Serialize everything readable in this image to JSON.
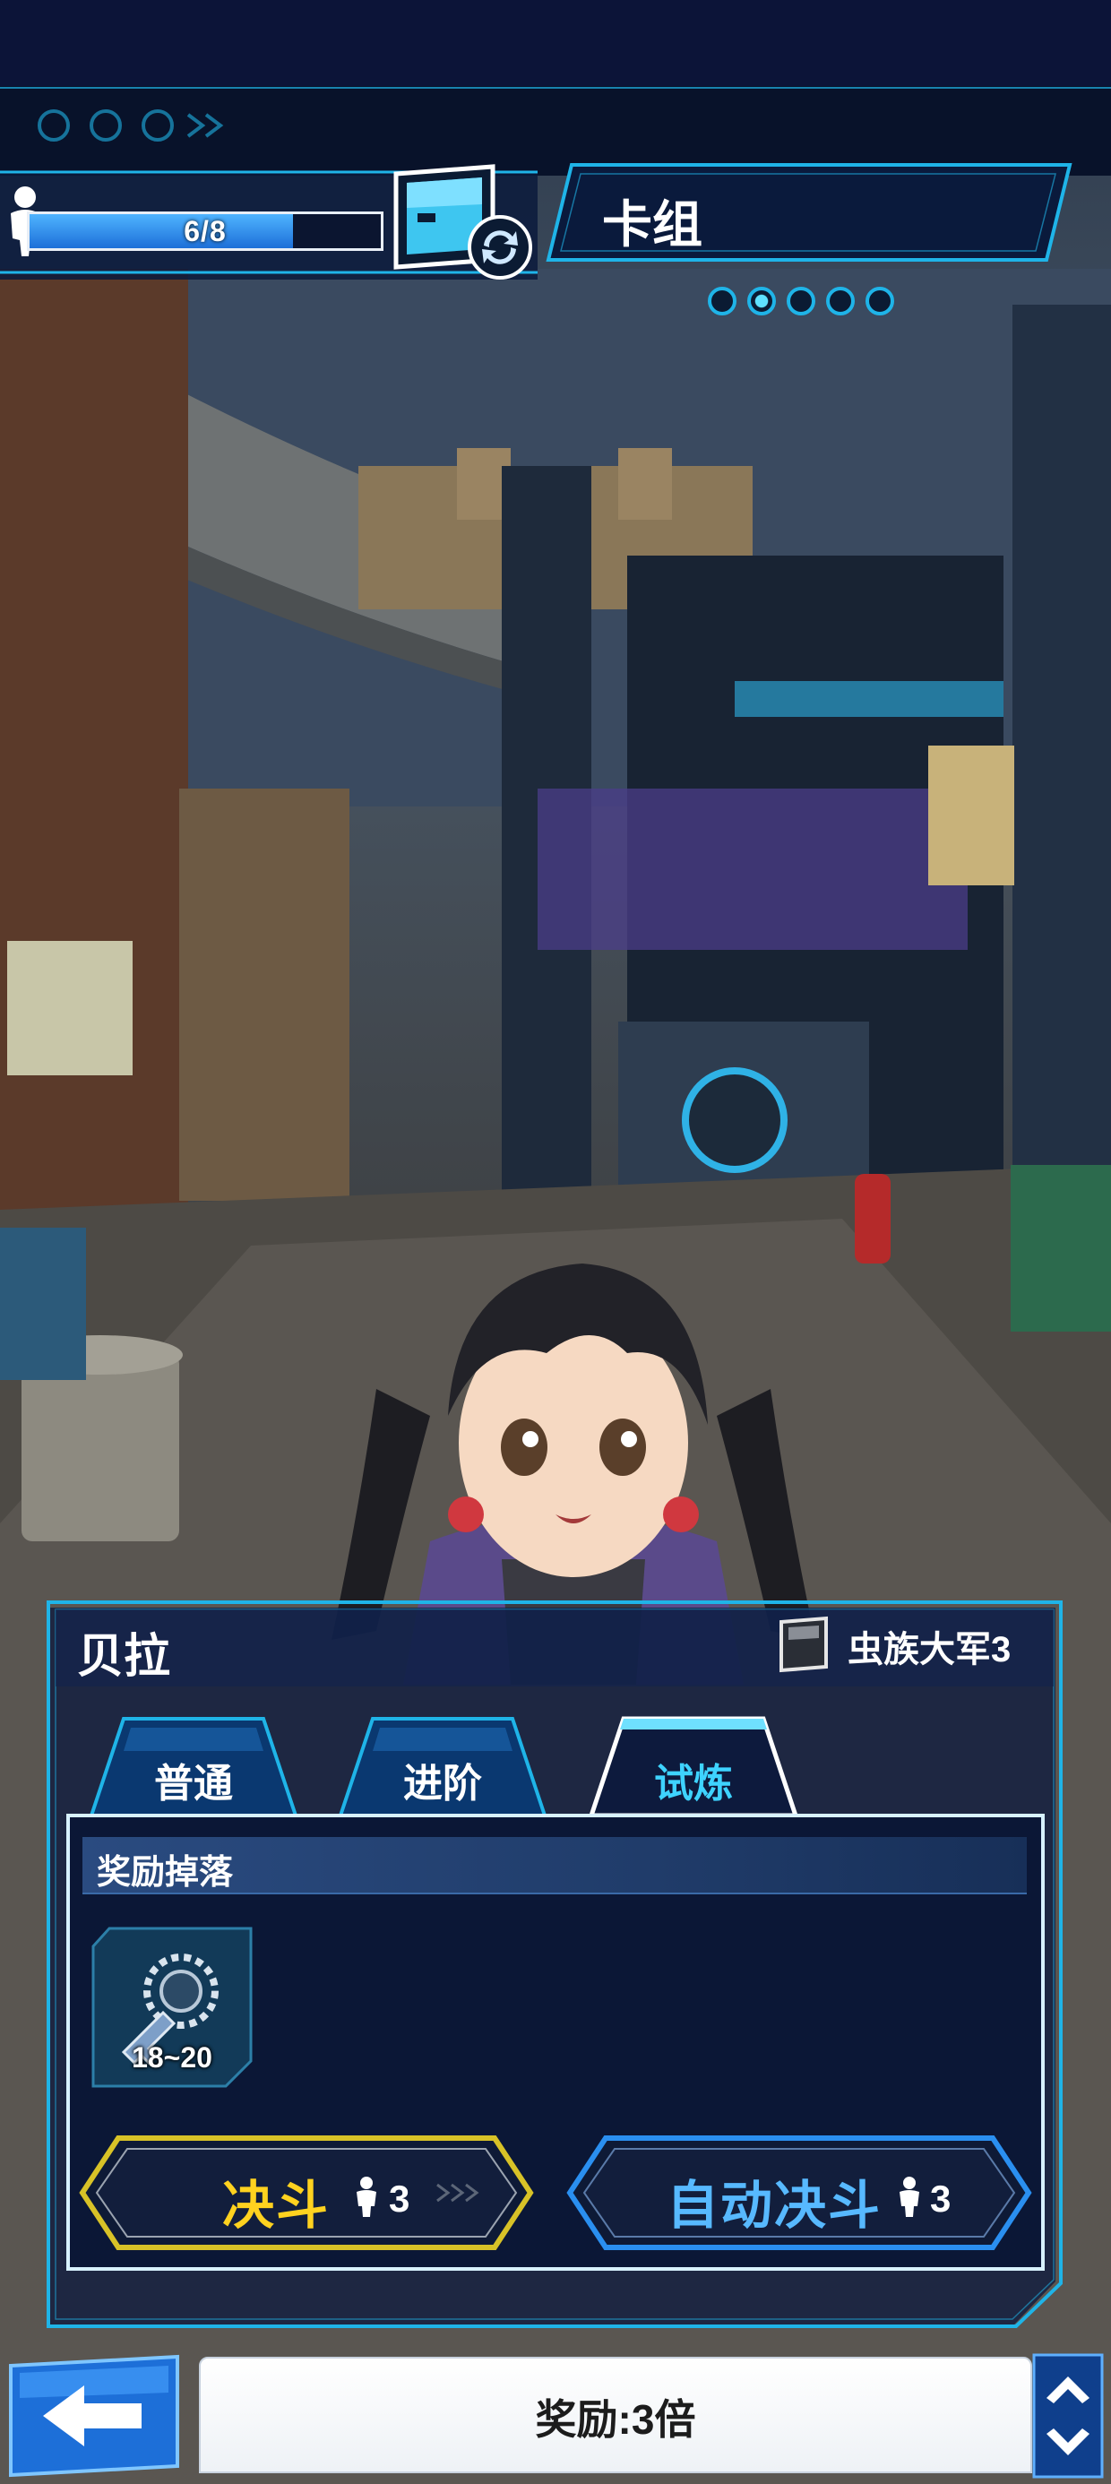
{
  "hud": {
    "stamina_text": "6/8",
    "stamina_fraction": 0.75,
    "deck_label": "卡组",
    "pager": {
      "count": 5,
      "active_index": 1
    }
  },
  "opponent": {
    "name": "贝拉",
    "deck_name": "虫族大军3"
  },
  "tabs": [
    {
      "label": "普通",
      "active": false
    },
    {
      "label": "进阶",
      "active": false
    },
    {
      "label": "试炼",
      "active": true
    }
  ],
  "rewards": {
    "title": "奖励掉落",
    "items": [
      {
        "icon": "key-icon",
        "count": "18~20"
      }
    ]
  },
  "actions": {
    "duel_label": "决斗",
    "duel_cost": "3",
    "auto_duel_label": "自动决斗",
    "auto_duel_cost": "3"
  },
  "footer": {
    "multiplier_text": "奖励:3倍"
  },
  "colors": {
    "accent_cyan": "#1fb4e8",
    "duel_yellow": "#ffd21f",
    "auto_blue": "#57b9ff",
    "panel_navy": "#0d1a3d",
    "stamina_blue": "#2a8ff0"
  }
}
